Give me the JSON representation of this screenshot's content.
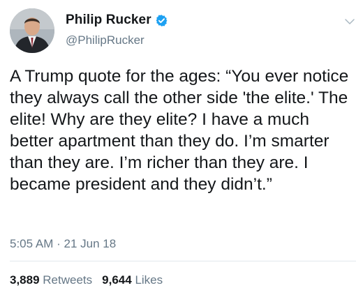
{
  "author": {
    "display_name": "Philip Rucker",
    "handle": "@PhilipRucker",
    "verified": true
  },
  "tweet": {
    "text": "A Trump quote for the ages: “You ever notice they always call the other side 'the elite.' The elite! Why are they elite? I have a much better apartment than they do. I’m smarter than they are. I’m richer than they are. I became president and they didn’t.”",
    "time": "5:05 AM",
    "separator": " · ",
    "date": "21 Jun 18"
  },
  "stats": {
    "retweets_count": "3,889",
    "retweets_label": "Retweets",
    "likes_count": "9,644",
    "likes_label": "Likes"
  },
  "icons": {
    "verified": "verified-badge-icon",
    "menu": "chevron-down-icon"
  },
  "colors": {
    "text": "#14171a",
    "secondary": "#657786",
    "verified_blue": "#1da1f2",
    "divider": "#e1e8ed"
  }
}
